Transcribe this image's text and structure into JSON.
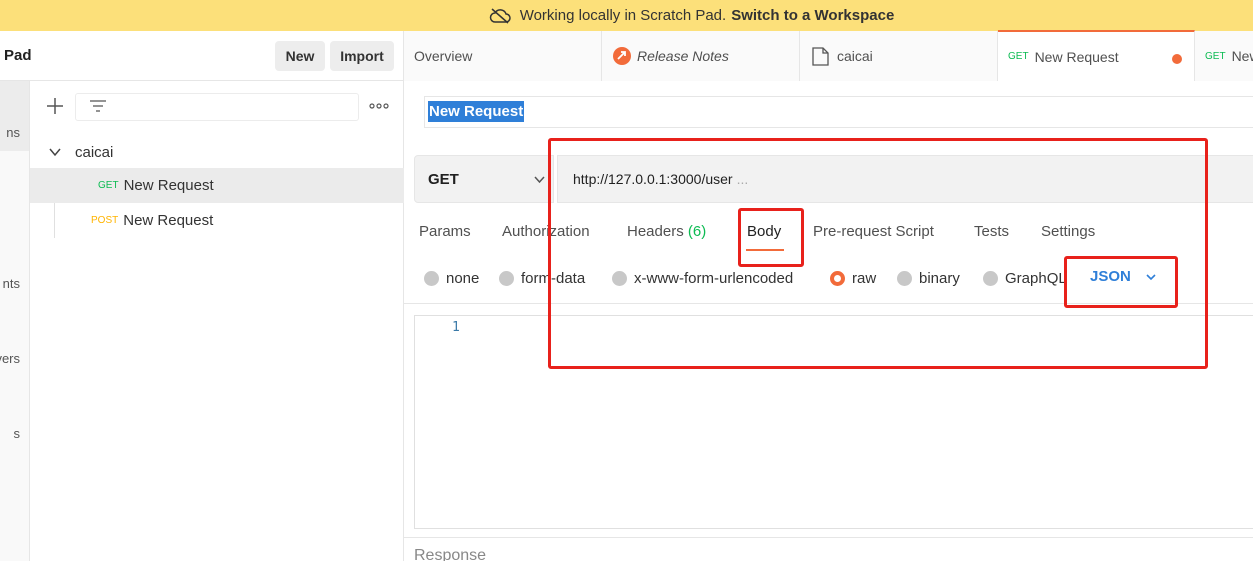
{
  "banner": {
    "text": "Working locally in Scratch Pad.",
    "link": "Switch to a Workspace",
    "icon": "cloud-off-icon"
  },
  "rail": {
    "items": [
      "ns",
      "nts",
      "vers",
      "s"
    ]
  },
  "sidebar": {
    "title": "Pad",
    "new_label": "New",
    "import_label": "Import",
    "collection": {
      "name": "caicai",
      "requests": [
        {
          "method": "GET",
          "name": "New Request",
          "method_color": "#0cbb52"
        },
        {
          "method": "POST",
          "name": "New Request",
          "method_color": "#ffb400"
        }
      ]
    }
  },
  "tabs": [
    {
      "label": "Overview"
    },
    {
      "label": "Release Notes",
      "icon": "release-notes-icon"
    },
    {
      "label": "caicai",
      "icon": "collection-icon"
    },
    {
      "method": "GET",
      "label": "New Request",
      "active": true,
      "unsaved": true
    },
    {
      "method": "GET",
      "label": "New"
    }
  ],
  "request": {
    "name": "New Request",
    "method": "GET",
    "url": "http://127.0.0.1:3000/user",
    "url_ellipsis": "...",
    "tabs": [
      {
        "label": "Params"
      },
      {
        "label": "Authorization"
      },
      {
        "label": "Headers",
        "count": "(6)"
      },
      {
        "label": "Body",
        "active": true
      },
      {
        "label": "Pre-request Script"
      },
      {
        "label": "Tests"
      },
      {
        "label": "Settings"
      }
    ],
    "body_types": [
      {
        "label": "none",
        "selected": false
      },
      {
        "label": "form-data",
        "selected": false
      },
      {
        "label": "x-www-form-urlencoded",
        "selected": false
      },
      {
        "label": "raw",
        "selected": true
      },
      {
        "label": "binary",
        "selected": false
      },
      {
        "label": "GraphQL",
        "selected": false
      }
    ],
    "raw_format": "JSON",
    "editor_line": "1"
  },
  "response": {
    "label": "Response"
  },
  "colors": {
    "accent": "#f26b3a",
    "banner": "#fce07a",
    "link_blue": "#2f7fd8",
    "annotation_red": "#e8211b"
  }
}
